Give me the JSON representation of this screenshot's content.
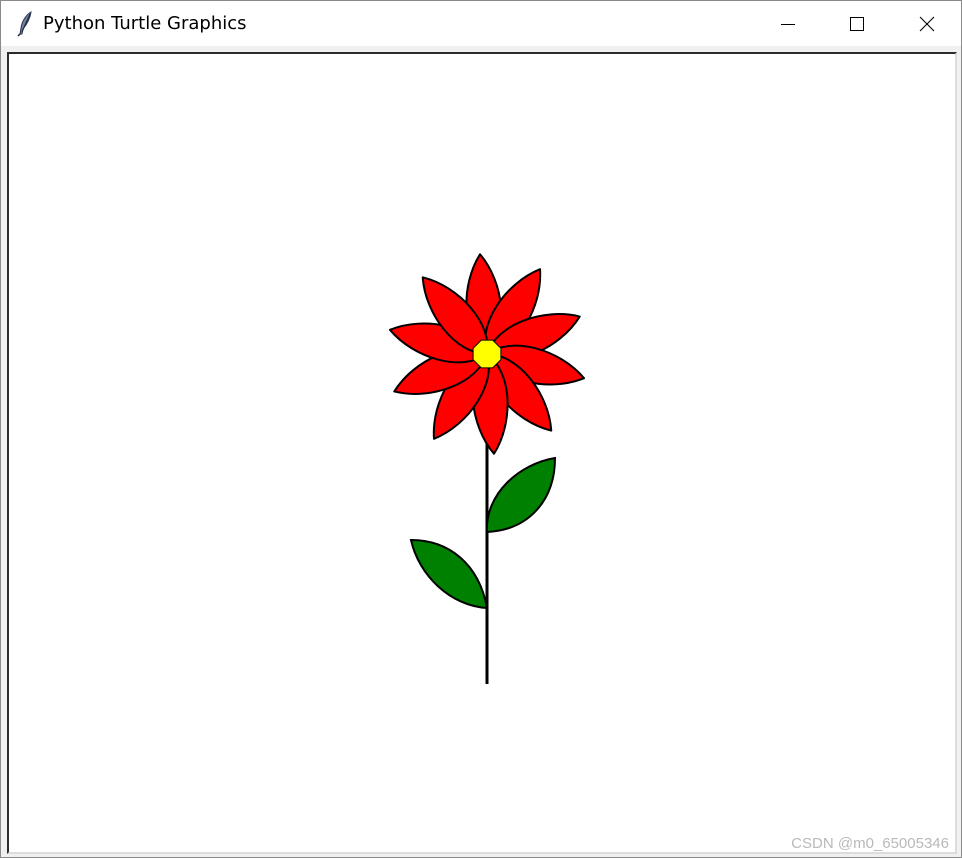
{
  "window": {
    "title": "Python Turtle Graphics",
    "icon": "feather-icon"
  },
  "controls": {
    "minimize": "minimize-icon",
    "maximize": "maximize-icon",
    "close": "close-icon"
  },
  "drawing": {
    "petal_fill": "#ff0000",
    "center_fill": "#ffff00",
    "leaf_fill": "#008000",
    "outline_color": "#000000",
    "petal_count": 10,
    "leaf_count": 2
  },
  "watermark": {
    "text": "CSDN @m0_65005346"
  }
}
